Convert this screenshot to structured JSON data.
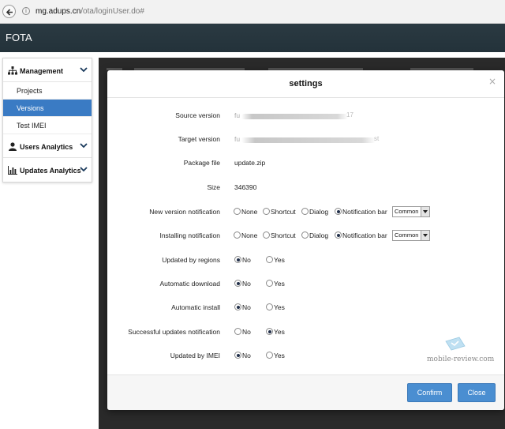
{
  "browser": {
    "url_host": "mg.adups.cn",
    "url_path": "/ota/loginUser.do#"
  },
  "app": {
    "title": "FOTA"
  },
  "sidebar": {
    "sections": [
      {
        "label": "Management",
        "icon": "sitemap-icon",
        "expanded": true,
        "items": [
          {
            "label": "Projects",
            "active": false
          },
          {
            "label": "Versions",
            "active": true
          },
          {
            "label": "Test IMEI",
            "active": false
          }
        ]
      },
      {
        "label": "Users Analytics",
        "icon": "user-icon",
        "expanded": false
      },
      {
        "label": "Updates Analytics",
        "icon": "bar-chart-icon",
        "expanded": false
      }
    ]
  },
  "modal": {
    "title": "settings",
    "source_version": {
      "label": "Source version",
      "value_prefix": "fu",
      "value_suffix": "17"
    },
    "target_version": {
      "label": "Target version",
      "value_prefix": "fu",
      "value_suffix": "st"
    },
    "package_file": {
      "label": "Package file",
      "value": "update.zip"
    },
    "size": {
      "label": "Size",
      "value": "346390"
    },
    "new_version_notification": {
      "label": "New version notification",
      "options": [
        "None",
        "Shortcut",
        "Dialog",
        "Notification bar"
      ],
      "selected": "Notification bar",
      "select_value": "Common"
    },
    "installing_notification": {
      "label": "Installing notification",
      "options": [
        "None",
        "Shortcut",
        "Dialog",
        "Notification bar"
      ],
      "selected": "Notification bar",
      "select_value": "Common"
    },
    "toggles": [
      {
        "label": "Updated by regions",
        "no": "No",
        "yes": "Yes",
        "selected": "No"
      },
      {
        "label": "Automatic download",
        "no": "No",
        "yes": "Yes",
        "selected": "No"
      },
      {
        "label": "Automatic install",
        "no": "No",
        "yes": "Yes",
        "selected": "No"
      },
      {
        "label": "Successful updates notification",
        "no": "No",
        "yes": "Yes",
        "selected": "Yes"
      },
      {
        "label": "Updated by IMEI",
        "no": "No",
        "yes": "Yes",
        "selected": "No"
      }
    ],
    "confirm_label": "Confirm",
    "close_label": "Close",
    "close_glyph": "×"
  },
  "watermark": {
    "text": "mobile-review.com"
  },
  "colors": {
    "accent": "#3a7bc4",
    "header": "#263238",
    "button": "#4a8ed1"
  }
}
